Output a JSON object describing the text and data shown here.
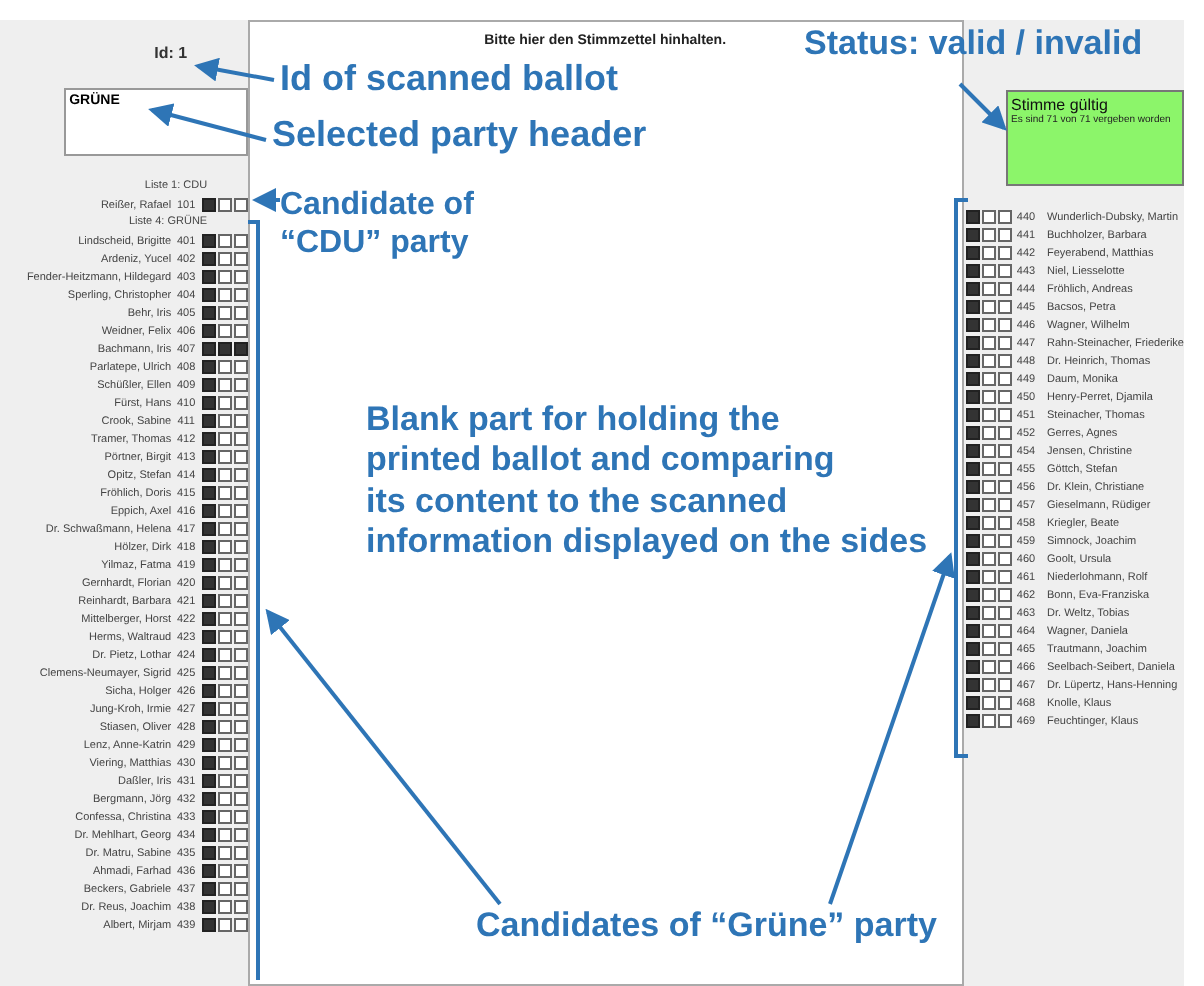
{
  "instruction": "Bitte hier den Stimmzettel hinhalten.",
  "ballot_id": "Id: 1",
  "party_header": "GRÜNE",
  "status": {
    "valid": true,
    "title": "Stimme gültig",
    "detail": "Es sind 71 von 71 vergeben worden"
  },
  "left_list": [
    {
      "kind": "header",
      "text": "Liste 1: CDU"
    },
    {
      "kind": "candidate",
      "name": "Reißer, Rafael",
      "number": "101",
      "checked": [
        true,
        false,
        false
      ]
    },
    {
      "kind": "header",
      "text": "Liste 4: GRÜNE"
    },
    {
      "kind": "candidate",
      "name": "Lindscheid, Brigitte",
      "number": "401",
      "checked": [
        true,
        false,
        false
      ]
    },
    {
      "kind": "candidate",
      "name": "Ardeniz, Yucel",
      "number": "402",
      "checked": [
        true,
        false,
        false
      ]
    },
    {
      "kind": "candidate",
      "name": "Fender-Heitzmann, Hildegard",
      "number": "403",
      "checked": [
        true,
        false,
        false
      ]
    },
    {
      "kind": "candidate",
      "name": "Sperling, Christopher",
      "number": "404",
      "checked": [
        true,
        false,
        false
      ]
    },
    {
      "kind": "candidate",
      "name": "Behr, Iris",
      "number": "405",
      "checked": [
        true,
        false,
        false
      ]
    },
    {
      "kind": "candidate",
      "name": "Weidner, Felix",
      "number": "406",
      "checked": [
        true,
        false,
        false
      ]
    },
    {
      "kind": "candidate",
      "name": "Bachmann, Iris",
      "number": "407",
      "checked": [
        true,
        true,
        true
      ]
    },
    {
      "kind": "candidate",
      "name": "Parlatepe, Ulrich",
      "number": "408",
      "checked": [
        true,
        false,
        false
      ]
    },
    {
      "kind": "candidate",
      "name": "Schüßler, Ellen",
      "number": "409",
      "checked": [
        true,
        false,
        false
      ]
    },
    {
      "kind": "candidate",
      "name": "Fürst, Hans",
      "number": "410",
      "checked": [
        true,
        false,
        false
      ]
    },
    {
      "kind": "candidate",
      "name": "Crook, Sabine",
      "number": "411",
      "checked": [
        true,
        false,
        false
      ]
    },
    {
      "kind": "candidate",
      "name": "Tramer, Thomas",
      "number": "412",
      "checked": [
        true,
        false,
        false
      ]
    },
    {
      "kind": "candidate",
      "name": "Pörtner, Birgit",
      "number": "413",
      "checked": [
        true,
        false,
        false
      ]
    },
    {
      "kind": "candidate",
      "name": "Opitz, Stefan",
      "number": "414",
      "checked": [
        true,
        false,
        false
      ]
    },
    {
      "kind": "candidate",
      "name": "Fröhlich, Doris",
      "number": "415",
      "checked": [
        true,
        false,
        false
      ]
    },
    {
      "kind": "candidate",
      "name": "Eppich, Axel",
      "number": "416",
      "checked": [
        true,
        false,
        false
      ]
    },
    {
      "kind": "candidate",
      "name": "Dr. Schwaßmann, Helena",
      "number": "417",
      "checked": [
        true,
        false,
        false
      ]
    },
    {
      "kind": "candidate",
      "name": "Hölzer, Dirk",
      "number": "418",
      "checked": [
        true,
        false,
        false
      ]
    },
    {
      "kind": "candidate",
      "name": "Yilmaz, Fatma",
      "number": "419",
      "checked": [
        true,
        false,
        false
      ]
    },
    {
      "kind": "candidate",
      "name": "Gernhardt, Florian",
      "number": "420",
      "checked": [
        true,
        false,
        false
      ]
    },
    {
      "kind": "candidate",
      "name": "Reinhardt, Barbara",
      "number": "421",
      "checked": [
        true,
        false,
        false
      ]
    },
    {
      "kind": "candidate",
      "name": "Mittelberger, Horst",
      "number": "422",
      "checked": [
        true,
        false,
        false
      ]
    },
    {
      "kind": "candidate",
      "name": "Herms, Waltraud",
      "number": "423",
      "checked": [
        true,
        false,
        false
      ]
    },
    {
      "kind": "candidate",
      "name": "Dr. Pietz, Lothar",
      "number": "424",
      "checked": [
        true,
        false,
        false
      ]
    },
    {
      "kind": "candidate",
      "name": "Clemens-Neumayer, Sigrid",
      "number": "425",
      "checked": [
        true,
        false,
        false
      ]
    },
    {
      "kind": "candidate",
      "name": "Sicha, Holger",
      "number": "426",
      "checked": [
        true,
        false,
        false
      ]
    },
    {
      "kind": "candidate",
      "name": "Jung-Kroh, Irmie",
      "number": "427",
      "checked": [
        true,
        false,
        false
      ]
    },
    {
      "kind": "candidate",
      "name": "Stiasen, Oliver",
      "number": "428",
      "checked": [
        true,
        false,
        false
      ]
    },
    {
      "kind": "candidate",
      "name": "Lenz, Anne-Katrin",
      "number": "429",
      "checked": [
        true,
        false,
        false
      ]
    },
    {
      "kind": "candidate",
      "name": "Viering, Matthias",
      "number": "430",
      "checked": [
        true,
        false,
        false
      ]
    },
    {
      "kind": "candidate",
      "name": "Daßler, Iris",
      "number": "431",
      "checked": [
        true,
        false,
        false
      ]
    },
    {
      "kind": "candidate",
      "name": "Bergmann, Jörg",
      "number": "432",
      "checked": [
        true,
        false,
        false
      ]
    },
    {
      "kind": "candidate",
      "name": "Confessa, Christina",
      "number": "433",
      "checked": [
        true,
        false,
        false
      ]
    },
    {
      "kind": "candidate",
      "name": "Dr. Mehlhart, Georg",
      "number": "434",
      "checked": [
        true,
        false,
        false
      ]
    },
    {
      "kind": "candidate",
      "name": "Dr. Matru, Sabine",
      "number": "435",
      "checked": [
        true,
        false,
        false
      ]
    },
    {
      "kind": "candidate",
      "name": "Ahmadi, Farhad",
      "number": "436",
      "checked": [
        true,
        false,
        false
      ]
    },
    {
      "kind": "candidate",
      "name": "Beckers, Gabriele",
      "number": "437",
      "checked": [
        true,
        false,
        false
      ]
    },
    {
      "kind": "candidate",
      "name": "Dr. Reus, Joachim",
      "number": "438",
      "checked": [
        true,
        false,
        false
      ]
    },
    {
      "kind": "candidate",
      "name": "Albert, Mirjam",
      "number": "439",
      "checked": [
        true,
        false,
        false
      ]
    }
  ],
  "right_list": [
    {
      "name": "Wunderlich-Dubsky, Martin",
      "number": "440",
      "checked": [
        true,
        false,
        false
      ]
    },
    {
      "name": "Buchholzer, Barbara",
      "number": "441",
      "checked": [
        true,
        false,
        false
      ]
    },
    {
      "name": "Feyerabend, Matthias",
      "number": "442",
      "checked": [
        true,
        false,
        false
      ]
    },
    {
      "name": "Niel, Liesselotte",
      "number": "443",
      "checked": [
        true,
        false,
        false
      ]
    },
    {
      "name": "Fröhlich, Andreas",
      "number": "444",
      "checked": [
        true,
        false,
        false
      ]
    },
    {
      "name": "Bacsos, Petra",
      "number": "445",
      "checked": [
        true,
        false,
        false
      ]
    },
    {
      "name": "Wagner, Wilhelm",
      "number": "446",
      "checked": [
        true,
        false,
        false
      ]
    },
    {
      "name": "Rahn-Steinacher, Friederike",
      "number": "447",
      "checked": [
        true,
        false,
        false
      ]
    },
    {
      "name": "Dr. Heinrich, Thomas",
      "number": "448",
      "checked": [
        true,
        false,
        false
      ]
    },
    {
      "name": "Daum, Monika",
      "number": "449",
      "checked": [
        true,
        false,
        false
      ]
    },
    {
      "name": "Henry-Perret, Djamila",
      "number": "450",
      "checked": [
        true,
        false,
        false
      ]
    },
    {
      "name": "Steinacher, Thomas",
      "number": "451",
      "checked": [
        true,
        false,
        false
      ]
    },
    {
      "name": "Gerres, Agnes",
      "number": "452",
      "checked": [
        true,
        false,
        false
      ]
    },
    {
      "name": "Jensen, Christine",
      "number": "454",
      "checked": [
        true,
        false,
        false
      ]
    },
    {
      "name": "Göttch, Stefan",
      "number": "455",
      "checked": [
        true,
        false,
        false
      ]
    },
    {
      "name": "Dr. Klein, Christiane",
      "number": "456",
      "checked": [
        true,
        false,
        false
      ]
    },
    {
      "name": "Gieselmann, Rüdiger",
      "number": "457",
      "checked": [
        true,
        false,
        false
      ]
    },
    {
      "name": "Kriegler, Beate",
      "number": "458",
      "checked": [
        true,
        false,
        false
      ]
    },
    {
      "name": "Simnock, Joachim",
      "number": "459",
      "checked": [
        true,
        false,
        false
      ]
    },
    {
      "name": "Goolt, Ursula",
      "number": "460",
      "checked": [
        true,
        false,
        false
      ]
    },
    {
      "name": "Niederlohmann, Rolf",
      "number": "461",
      "checked": [
        true,
        false,
        false
      ]
    },
    {
      "name": "Bonn, Eva-Franziska",
      "number": "462",
      "checked": [
        true,
        false,
        false
      ]
    },
    {
      "name": "Dr. Weltz, Tobias",
      "number": "463",
      "checked": [
        true,
        false,
        false
      ]
    },
    {
      "name": "Wagner, Daniela",
      "number": "464",
      "checked": [
        true,
        false,
        false
      ]
    },
    {
      "name": "Trautmann, Joachim",
      "number": "465",
      "checked": [
        true,
        false,
        false
      ]
    },
    {
      "name": "Seelbach-Seibert, Daniela",
      "number": "466",
      "checked": [
        true,
        false,
        false
      ]
    },
    {
      "name": "Dr. Lüpertz, Hans-Henning",
      "number": "467",
      "checked": [
        true,
        false,
        false
      ]
    },
    {
      "name": "Knolle, Klaus",
      "number": "468",
      "checked": [
        true,
        false,
        false
      ]
    },
    {
      "name": "Feuchtinger, Klaus",
      "number": "469",
      "checked": [
        true,
        false,
        false
      ]
    }
  ],
  "annotations": [
    {
      "text": "Status: valid / invalid"
    },
    {
      "text": "Id of scanned ballot"
    },
    {
      "text": "Selected party header"
    },
    {
      "text": "Candidate of\n“CDU” party"
    },
    {
      "text": "Blank part for holding the\nprinted ballot and comparing\nits content to the scanned\ninformation displayed on the sides"
    },
    {
      "text": "Candidates of “Grüne” party"
    }
  ]
}
